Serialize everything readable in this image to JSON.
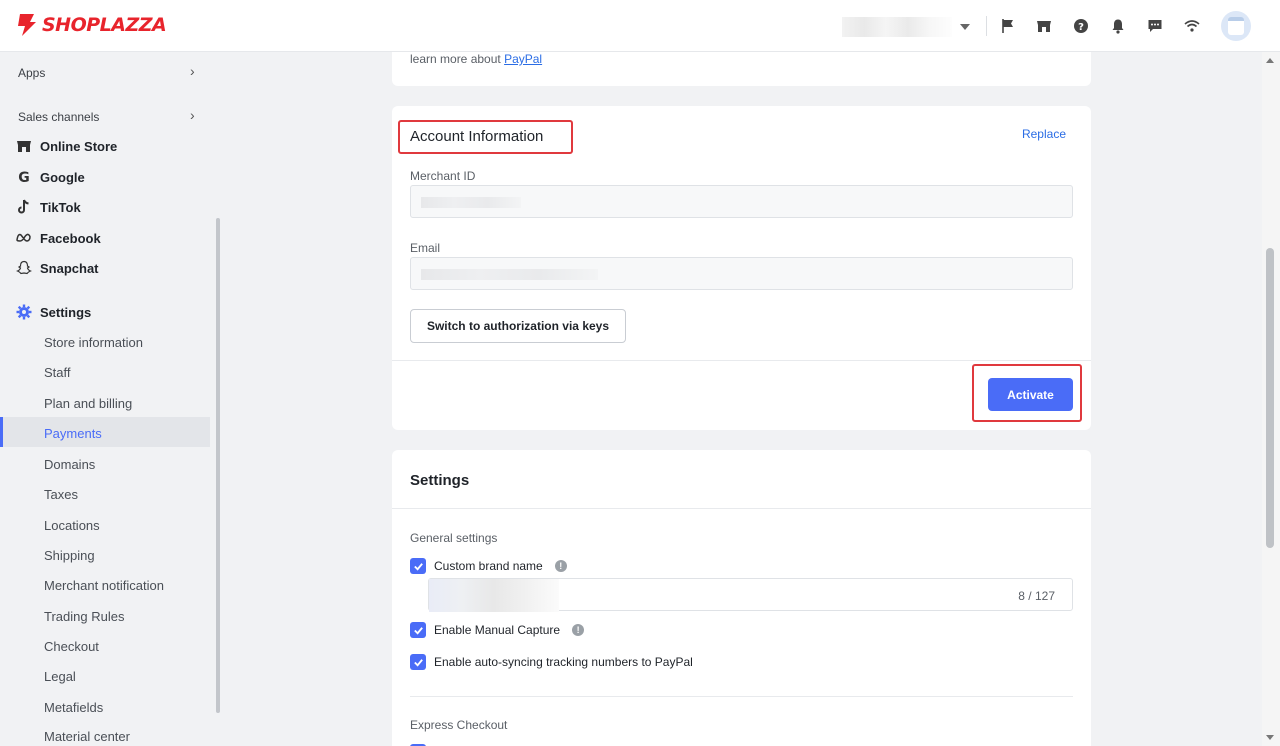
{
  "brand": {
    "name": "SHOPLAZZA",
    "color": "#e8242c"
  },
  "topbar": {
    "icons": [
      "flag-icon",
      "store-icon",
      "help-icon",
      "bell-icon",
      "chat-icon",
      "wifi-icon"
    ]
  },
  "sidebar": {
    "apps_label": "Apps",
    "sales_channels_label": "Sales channels",
    "channels": [
      {
        "label": "Online Store",
        "icon": "store-icon"
      },
      {
        "label": "Google",
        "icon": "google-icon"
      },
      {
        "label": "TikTok",
        "icon": "tiktok-icon"
      },
      {
        "label": "Facebook",
        "icon": "meta-icon"
      },
      {
        "label": "Snapchat",
        "icon": "snapchat-icon"
      }
    ],
    "settings_label": "Settings",
    "settings_items": [
      "Store information",
      "Staff",
      "Plan and billing",
      "Payments",
      "Domains",
      "Taxes",
      "Locations",
      "Shipping",
      "Merchant notification",
      "Trading Rules",
      "Checkout",
      "Legal",
      "Metafields",
      "Material center"
    ],
    "active_item": "Payments"
  },
  "main": {
    "paypal_prefix": "learn more about",
    "paypal_link": "PayPal",
    "account": {
      "title": "Account Information",
      "replace_label": "Replace",
      "merchant_id_label": "Merchant ID",
      "email_label": "Email",
      "switch_button": "Switch to authorization via keys",
      "activate_button": "Activate"
    },
    "settings": {
      "title": "Settings",
      "general_label": "General settings",
      "custom_brand_label": "Custom brand name",
      "brand_count": "8 / 127",
      "manual_capture_label": "Enable Manual Capture",
      "auto_sync_label": "Enable auto-syncing tracking numbers to PayPal",
      "express_label": "Express Checkout"
    }
  },
  "colors": {
    "accent": "#4a6cf7",
    "highlight": "#e0393e",
    "link": "#2b6de5"
  }
}
